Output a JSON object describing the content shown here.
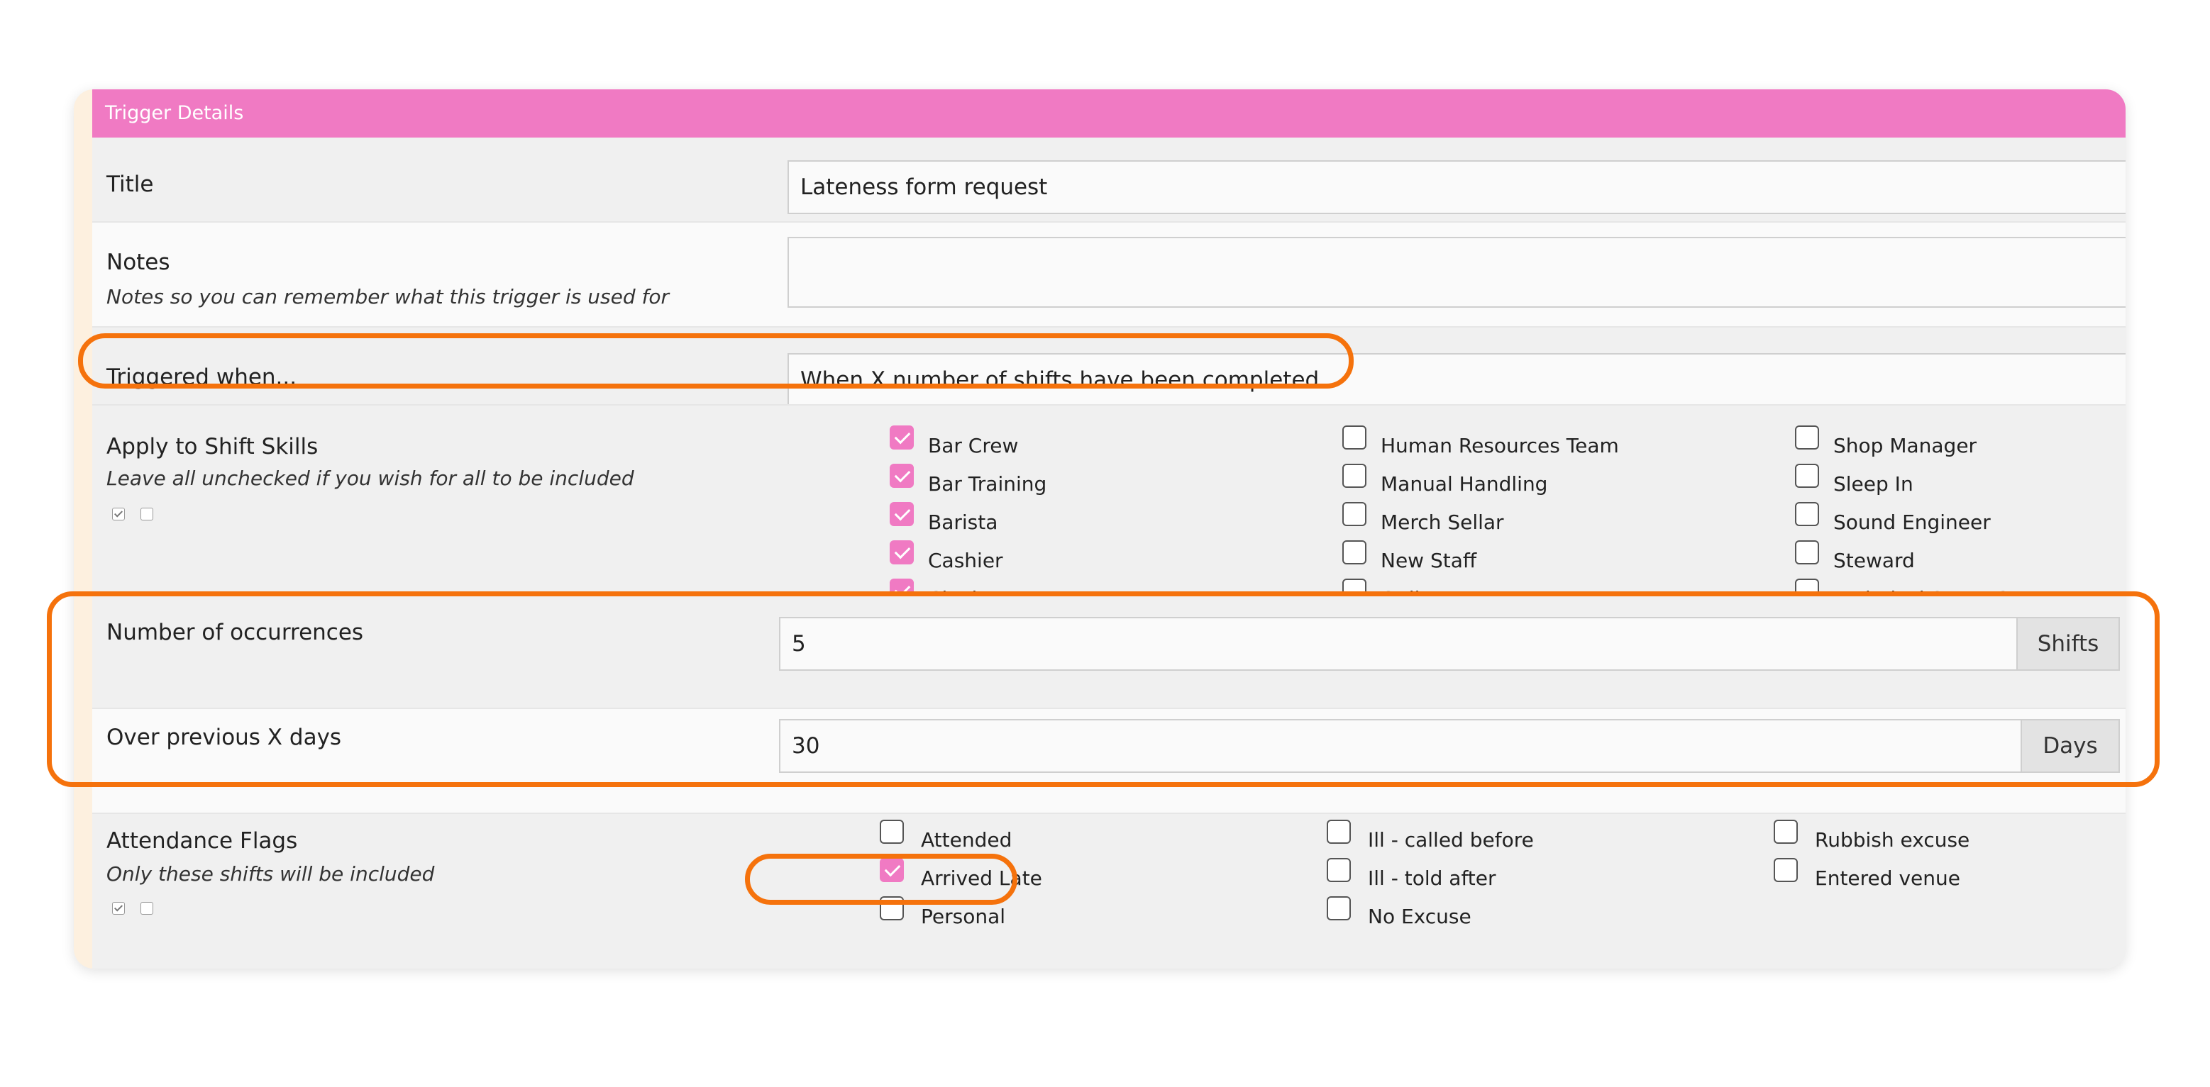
{
  "section_title": "Trigger Details",
  "title": {
    "label": "Title",
    "value": "Lateness form request"
  },
  "notes": {
    "label": "Notes",
    "help": "Notes so you can remember what this trigger is used for",
    "value": ""
  },
  "triggered_when": {
    "label": "Triggered when...",
    "value": "When X number of shifts have been completed"
  },
  "shift_skills": {
    "label": "Apply to Shift Skills",
    "help": "Leave all unchecked if you wish for all to be included",
    "items": [
      {
        "label": "Bar Crew",
        "checked": true
      },
      {
        "label": "Bar Training",
        "checked": true
      },
      {
        "label": "Barista",
        "checked": true
      },
      {
        "label": "Cashier",
        "checked": true
      },
      {
        "label": "Cloakroom",
        "checked": true
      },
      {
        "label": "Human Resources Team",
        "checked": false
      },
      {
        "label": "Manual Handling",
        "checked": false
      },
      {
        "label": "Merch Sellar",
        "checked": false
      },
      {
        "label": "New Staff",
        "checked": false
      },
      {
        "label": "Online PR",
        "checked": false
      },
      {
        "label": "Shop Manager",
        "checked": false
      },
      {
        "label": "Sleep In",
        "checked": false
      },
      {
        "label": "Sound Engineer",
        "checked": false
      },
      {
        "label": "Steward",
        "checked": false
      },
      {
        "label": "Technical Setup Crew",
        "checked": false
      }
    ]
  },
  "occurrences": {
    "label": "Number of occurrences",
    "value": "5",
    "unit": "Shifts"
  },
  "days": {
    "label": "Over previous X days",
    "value": "30",
    "unit": "Days"
  },
  "attendance_flags": {
    "label": "Attendance Flags",
    "help": "Only these shifts will be included",
    "items": [
      {
        "label": "Attended",
        "checked": false
      },
      {
        "label": "Arrived Late",
        "checked": true
      },
      {
        "label": "Personal",
        "checked": false
      },
      {
        "label": "Ill - called before",
        "checked": false
      },
      {
        "label": "Ill - told after",
        "checked": false
      },
      {
        "label": "No Excuse",
        "checked": false
      },
      {
        "label": "Rubbish excuse",
        "checked": false
      },
      {
        "label": "Entered venue",
        "checked": false
      }
    ]
  },
  "colors": {
    "accent": "#f07ac3",
    "highlight": "#f5720c"
  }
}
